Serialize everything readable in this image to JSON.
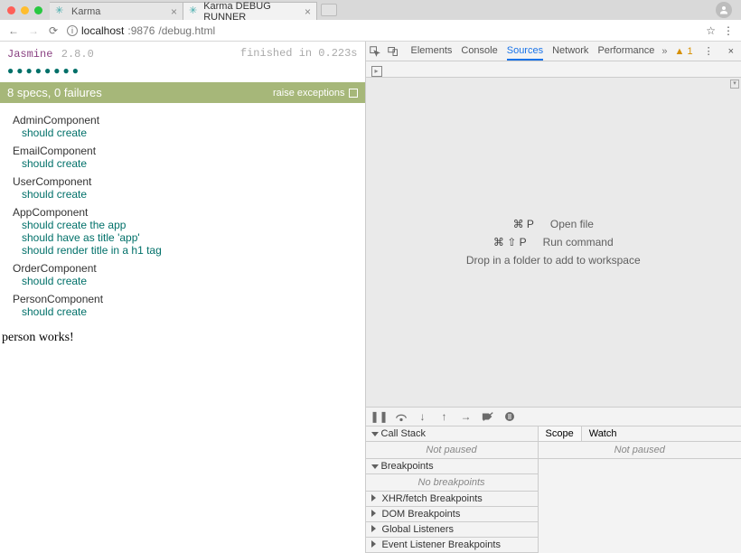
{
  "tabs": [
    {
      "title": "Karma",
      "active": false
    },
    {
      "title": "Karma DEBUG RUNNER",
      "active": true
    }
  ],
  "url": {
    "host": "localhost",
    "port": ":9876",
    "path": "/debug.html"
  },
  "jasmine": {
    "name": "Jasmine",
    "version": "2.8.0",
    "finished": "finished in 0.223s",
    "summary": "8 specs, 0 failures",
    "raise": "raise exceptions",
    "dots_count": 8,
    "suites": [
      {
        "name": "AdminComponent",
        "specs": [
          "should create"
        ]
      },
      {
        "name": "EmailComponent",
        "specs": [
          "should create"
        ]
      },
      {
        "name": "UserComponent",
        "specs": [
          "should create"
        ]
      },
      {
        "name": "AppComponent",
        "specs": [
          "should create the app",
          "should have as title 'app'",
          "should render title in a h1 tag"
        ]
      },
      {
        "name": "OrderComponent",
        "specs": [
          "should create"
        ]
      },
      {
        "name": "PersonComponent",
        "specs": [
          "should create"
        ]
      }
    ],
    "extra_text": "person works!"
  },
  "devtools": {
    "panels": [
      "Elements",
      "Console",
      "Sources",
      "Network",
      "Performance"
    ],
    "active_panel": "Sources",
    "more_glyph": "»",
    "warnings": "1",
    "empty": {
      "open_key": "⌘ P",
      "open_label": "Open file",
      "run_key": "⌘ ⇧ P",
      "run_label": "Run command",
      "drop": "Drop in a folder to add to workspace"
    },
    "debugger": {
      "sections": [
        "Call Stack",
        "Breakpoints",
        "XHR/fetch Breakpoints",
        "DOM Breakpoints",
        "Global Listeners",
        "Event Listener Breakpoints"
      ],
      "not_paused": "Not paused",
      "no_bp": "No breakpoints",
      "scope": "Scope",
      "watch": "Watch"
    }
  }
}
